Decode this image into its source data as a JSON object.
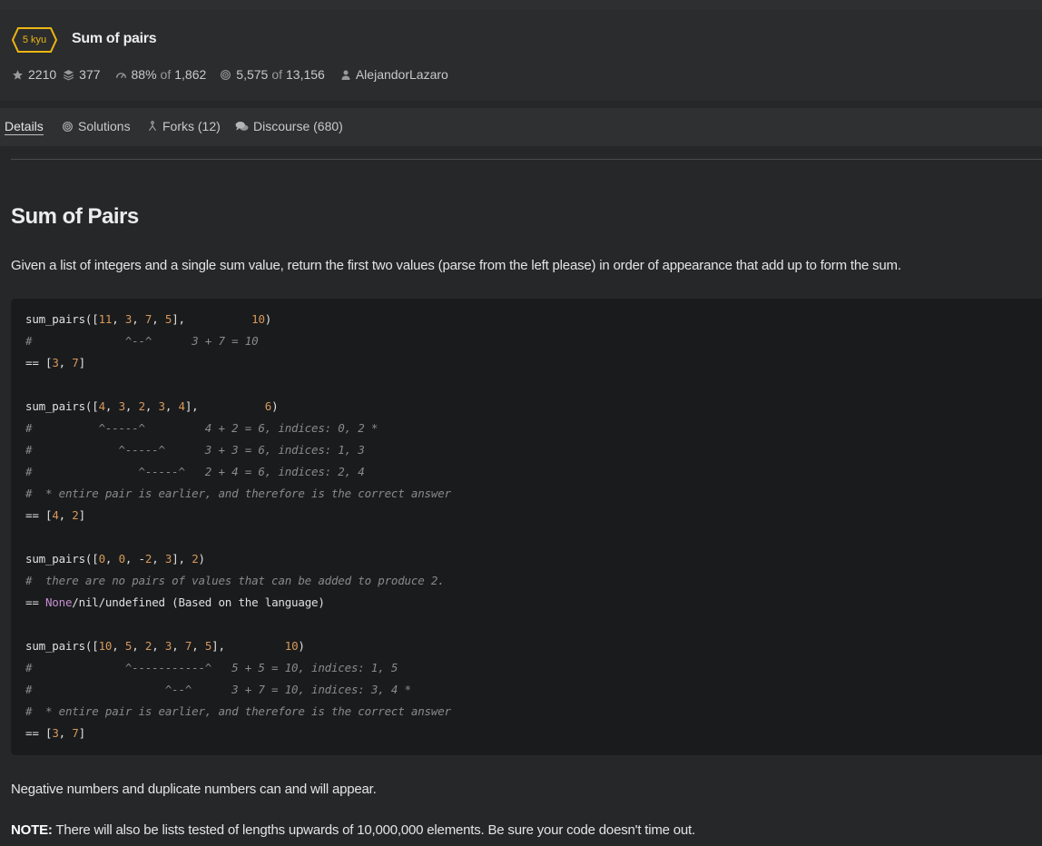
{
  "kata": {
    "rank": "5 kyu",
    "title": "Sum of pairs",
    "rank_color": "#ecb613"
  },
  "stats": {
    "stars": "2210",
    "collections": "377",
    "satisfaction_pct": "88%",
    "of_word": "of",
    "votes": "1,862",
    "completed": "5,575",
    "attempts": "13,156",
    "author": "AlejandorLazaro"
  },
  "tabs": {
    "details": "Details",
    "solutions": "Solutions",
    "forks": "Forks (12)",
    "discourse": "Discourse (680)"
  },
  "description": {
    "heading": "Sum of Pairs",
    "intro": "Given a list of integers and a single sum value, return the first two values (parse from the left please) in order of appearance that add up to form the sum.",
    "code_lines": [
      [
        [
          "t",
          "sum_pairs(["
        ],
        [
          "n",
          "11"
        ],
        [
          "t",
          ", "
        ],
        [
          "n",
          "3"
        ],
        [
          "t",
          ", "
        ],
        [
          "n",
          "7"
        ],
        [
          "t",
          ", "
        ],
        [
          "n",
          "5"
        ],
        [
          "t",
          "],          "
        ],
        [
          "n",
          "10"
        ],
        [
          "t",
          ")"
        ]
      ],
      [
        [
          "c",
          "#              ^--^      3 + 7 = 10"
        ]
      ],
      [
        [
          "t",
          "== ["
        ],
        [
          "n",
          "3"
        ],
        [
          "t",
          ", "
        ],
        [
          "n",
          "7"
        ],
        [
          "t",
          "]"
        ]
      ],
      [],
      [
        [
          "t",
          "sum_pairs(["
        ],
        [
          "n",
          "4"
        ],
        [
          "t",
          ", "
        ],
        [
          "n",
          "3"
        ],
        [
          "t",
          ", "
        ],
        [
          "n",
          "2"
        ],
        [
          "t",
          ", "
        ],
        [
          "n",
          "3"
        ],
        [
          "t",
          ", "
        ],
        [
          "n",
          "4"
        ],
        [
          "t",
          "],          "
        ],
        [
          "n",
          "6"
        ],
        [
          "t",
          ")"
        ]
      ],
      [
        [
          "c",
          "#          ^-----^         4 + 2 = 6, indices: 0, 2 *"
        ]
      ],
      [
        [
          "c",
          "#             ^-----^      3 + 3 = 6, indices: 1, 3"
        ]
      ],
      [
        [
          "c",
          "#                ^-----^   2 + 4 = 6, indices: 2, 4"
        ]
      ],
      [
        [
          "c",
          "#  * entire pair is earlier, and therefore is the correct answer"
        ]
      ],
      [
        [
          "t",
          "== ["
        ],
        [
          "n",
          "4"
        ],
        [
          "t",
          ", "
        ],
        [
          "n",
          "2"
        ],
        [
          "t",
          "]"
        ]
      ],
      [],
      [
        [
          "t",
          "sum_pairs(["
        ],
        [
          "n",
          "0"
        ],
        [
          "t",
          ", "
        ],
        [
          "n",
          "0"
        ],
        [
          "t",
          ", -"
        ],
        [
          "n",
          "2"
        ],
        [
          "t",
          ", "
        ],
        [
          "n",
          "3"
        ],
        [
          "t",
          "], "
        ],
        [
          "n",
          "2"
        ],
        [
          "t",
          ")"
        ]
      ],
      [
        [
          "c",
          "#  there are no pairs of values that can be added to produce 2."
        ]
      ],
      [
        [
          "t",
          "== "
        ],
        [
          "k",
          "None"
        ],
        [
          "t",
          "/nil/undefined (Based on the language)"
        ]
      ],
      [],
      [
        [
          "t",
          "sum_pairs(["
        ],
        [
          "n",
          "10"
        ],
        [
          "t",
          ", "
        ],
        [
          "n",
          "5"
        ],
        [
          "t",
          ", "
        ],
        [
          "n",
          "2"
        ],
        [
          "t",
          ", "
        ],
        [
          "n",
          "3"
        ],
        [
          "t",
          ", "
        ],
        [
          "n",
          "7"
        ],
        [
          "t",
          ", "
        ],
        [
          "n",
          "5"
        ],
        [
          "t",
          "],         "
        ],
        [
          "n",
          "10"
        ],
        [
          "t",
          ")"
        ]
      ],
      [
        [
          "c",
          "#              ^-----------^   5 + 5 = 10, indices: 1, 5"
        ]
      ],
      [
        [
          "c",
          "#                    ^--^      3 + 7 = 10, indices: 3, 4 *"
        ]
      ],
      [
        [
          "c",
          "#  * entire pair is earlier, and therefore is the correct answer"
        ]
      ],
      [
        [
          "t",
          "== ["
        ],
        [
          "n",
          "3"
        ],
        [
          "t",
          ", "
        ],
        [
          "n",
          "7"
        ],
        [
          "t",
          "]"
        ]
      ]
    ],
    "para1": "Negative numbers and duplicate numbers can and will appear.",
    "note_label": "NOTE:",
    "note_text": " There will also be lists tested of lengths upwards of 10,000,000 elements. Be sure your code doesn't time out."
  },
  "colors": {
    "number": "#d6985a",
    "keyword": "#c58fcf",
    "comment": "#8a8a8a"
  },
  "icons": [
    "star-icon",
    "collections-icon",
    "satisfaction-icon",
    "target-icon",
    "user-icon",
    "fork-icon",
    "discourse-icon"
  ]
}
